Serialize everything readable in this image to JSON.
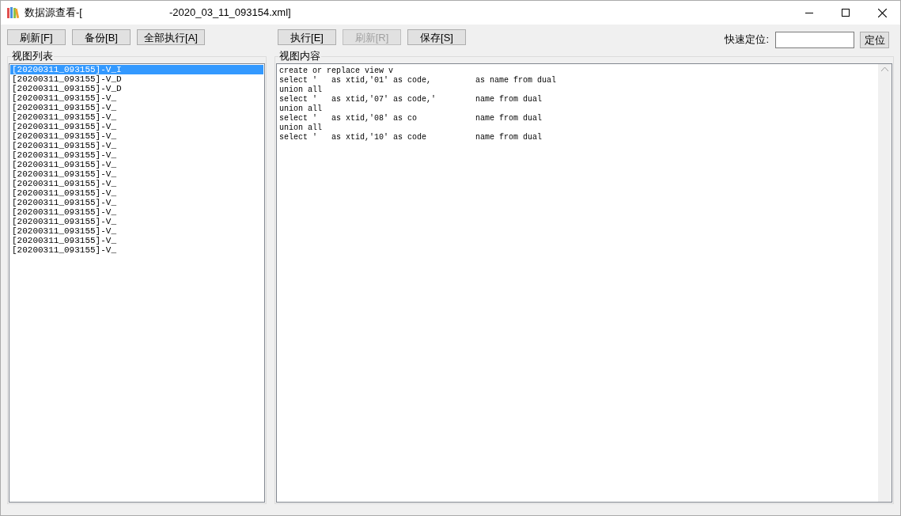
{
  "window": {
    "title": "数据源查看-[",
    "title_end": "-2020_03_11_093154.xml]"
  },
  "toolbar_left": [
    {
      "label": "刷新[F]",
      "disabled": false
    },
    {
      "label": "备份[B]",
      "disabled": false
    },
    {
      "label": "全部执行[A]",
      "disabled": false
    }
  ],
  "toolbar_right": [
    {
      "label": "执行[E]",
      "disabled": false
    },
    {
      "label": "刷新[R]",
      "disabled": true
    },
    {
      "label": "保存[S]",
      "disabled": false
    }
  ],
  "quick_locate": {
    "label": "快速定位:",
    "button": "定位"
  },
  "view_list": {
    "title": "视图列表",
    "items": [
      {
        "text": "[20200311_093155]-V_I",
        "selected": true
      },
      {
        "text": "[20200311_093155]-V_D",
        "selected": false
      },
      {
        "text": "[20200311_093155]-V_D",
        "selected": false
      },
      {
        "text": "[20200311_093155]-V_",
        "selected": false
      },
      {
        "text": "[20200311_093155]-V_",
        "selected": false
      },
      {
        "text": "[20200311_093155]-V_",
        "selected": false
      },
      {
        "text": "[20200311_093155]-V_",
        "selected": false
      },
      {
        "text": "[20200311_093155]-V_",
        "selected": false
      },
      {
        "text": "[20200311_093155]-V_",
        "selected": false
      },
      {
        "text": "[20200311_093155]-V_",
        "selected": false
      },
      {
        "text": "[20200311_093155]-V_",
        "selected": false
      },
      {
        "text": "[20200311_093155]-V_",
        "selected": false
      },
      {
        "text": "[20200311_093155]-V_",
        "selected": false
      },
      {
        "text": "[20200311_093155]-V_",
        "selected": false
      },
      {
        "text": "[20200311_093155]-V_",
        "selected": false
      },
      {
        "text": "[20200311_093155]-V_",
        "selected": false
      },
      {
        "text": "[20200311_093155]-V_",
        "selected": false
      },
      {
        "text": "[20200311_093155]-V_",
        "selected": false
      },
      {
        "text": "[20200311_093155]-V_",
        "selected": false
      },
      {
        "text": "[20200311_093155]-V_",
        "selected": false
      }
    ]
  },
  "view_content": {
    "title": "视图内容",
    "lines": [
      [
        "create or replace view v"
      ],
      [
        "select '",
        "as xtid,'01' as code,",
        "as name from dual"
      ],
      [
        "union all"
      ],
      [
        "select '",
        "as xtid,'07' as code,'",
        "name from dual"
      ],
      [
        "union all"
      ],
      [
        "select '",
        "as xtid,'08' as co",
        "name from dual"
      ],
      [
        "union all"
      ],
      [
        "select '",
        "as xtid,'10' as code",
        "name from dual"
      ]
    ]
  }
}
